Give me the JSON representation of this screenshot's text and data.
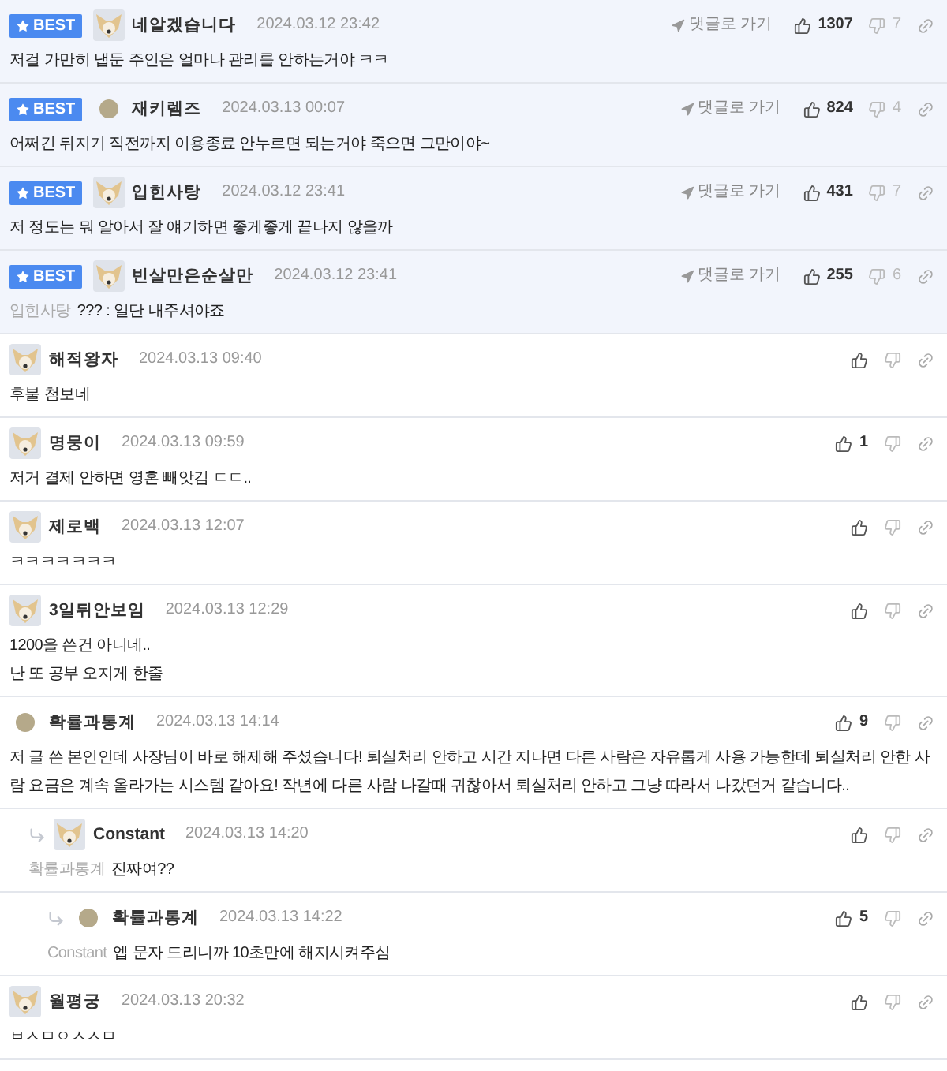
{
  "comments": [
    {
      "best": true,
      "best_label": "BEST",
      "name": "네알겠습니다",
      "date": "2024.03.12 23:42",
      "goto": "댓글로 가기",
      "likes": "1307",
      "dislikes": "7",
      "text": "저걸 가만히 냅둔 주인은 얼마나 관리를 안하는거야 ㅋㅋ"
    },
    {
      "best": true,
      "best_label": "BEST",
      "avatar": {
        "kind": "dot"
      },
      "name": "재키렘즈",
      "date": "2024.03.13 00:07",
      "goto": "댓글로 가기",
      "likes": "824",
      "dislikes": "4",
      "text": "어쩌긴 뒤지기 직전까지 이용종료 안누르면 되는거야 죽으면 그만이야~"
    },
    {
      "best": true,
      "best_label": "BEST",
      "name": "입힌사탕",
      "date": "2024.03.12 23:41",
      "goto": "댓글로 가기",
      "likes": "431",
      "dislikes": "7",
      "text": "저 정도는 뭐 알아서 잘 얘기하면 좋게좋게 끝나지 않을까"
    },
    {
      "best": true,
      "best_label": "BEST",
      "name": "빈살만은순살만",
      "date": "2024.03.12 23:41",
      "goto": "댓글로 가기",
      "likes": "255",
      "dislikes": "6",
      "mention": "입힌사탕",
      "text": "??? : 일단 내주셔야죠"
    },
    {
      "best": false,
      "name": "해적왕자",
      "date": "2024.03.13 09:40",
      "text": "후불 첨보네"
    },
    {
      "best": false,
      "name": "명뭉이",
      "date": "2024.03.13 09:59",
      "likes": "1",
      "text": "저거 결제 안하면 영혼 빼앗김 ㄷㄷ.."
    },
    {
      "best": false,
      "name": "제로백",
      "date": "2024.03.13 12:07",
      "text": "ㅋㅋㅋㅋㅋㅋㅋ"
    },
    {
      "best": false,
      "name": "3일뒤안보임",
      "date": "2024.03.13 12:29",
      "text": "1200을 쓴건 아니네..\n난 또 공부 오지게 한줄"
    },
    {
      "best": false,
      "avatar": {
        "kind": "dot"
      },
      "name": "확률과통계",
      "date": "2024.03.13 14:14",
      "likes": "9",
      "text": "저 글 쓴 본인인데 사장님이 바로 해제해 주셨습니다! 퇴실처리 안하고 시간 지나면 다른 사람은 자유롭게 사용 가능한데 퇴실처리 안한 사람 요금은 계속 올라가는 시스템 같아요! 작년에 다른 사람 나갈때 귀찮아서 퇴실처리 안하고 그냥 따라서 나갔던거 같습니다..",
      "children": [
        {
          "best": false,
          "name": "Constant",
          "date": "2024.03.13 14:20",
          "mention": "확률과통계",
          "text": "진짜여??",
          "children": [
            {
              "best": false,
              "avatar": {
                "kind": "dot"
              },
              "name": "확률과통계",
              "date": "2024.03.13 14:22",
              "likes": "5",
              "mention": "Constant",
              "text": "엡 문자 드리니까 10초만에 해지시켜주심"
            }
          ]
        }
      ]
    },
    {
      "best": false,
      "name": "월평궁",
      "date": "2024.03.13 20:32",
      "text": "ㅂㅅㅁㅇㅅㅅㅁ"
    }
  ]
}
